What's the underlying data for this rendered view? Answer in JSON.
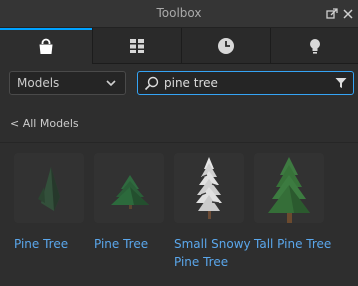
{
  "window": {
    "title": "Toolbox",
    "buttons": [
      {
        "icon": "undock-icon"
      },
      {
        "icon": "close-icon"
      }
    ]
  },
  "tabs": [
    {
      "icon": "shopping-bag-icon",
      "active": true
    },
    {
      "icon": "grid-icon",
      "active": false
    },
    {
      "icon": "clock-icon",
      "active": false
    },
    {
      "icon": "lightbulb-icon",
      "active": false
    }
  ],
  "category": {
    "selected": "Models"
  },
  "search": {
    "value": "pine tree"
  },
  "back_link": "< All Models",
  "results": [
    {
      "label": "Pine Tree"
    },
    {
      "label": "Pine Tree"
    },
    {
      "label": "Small Snowy Pine Tree"
    },
    {
      "label": "Tall Pine Tree"
    }
  ],
  "colors": {
    "accent": "#00a2ff",
    "link": "#5aa7ec",
    "background": "#2e2e2e"
  }
}
